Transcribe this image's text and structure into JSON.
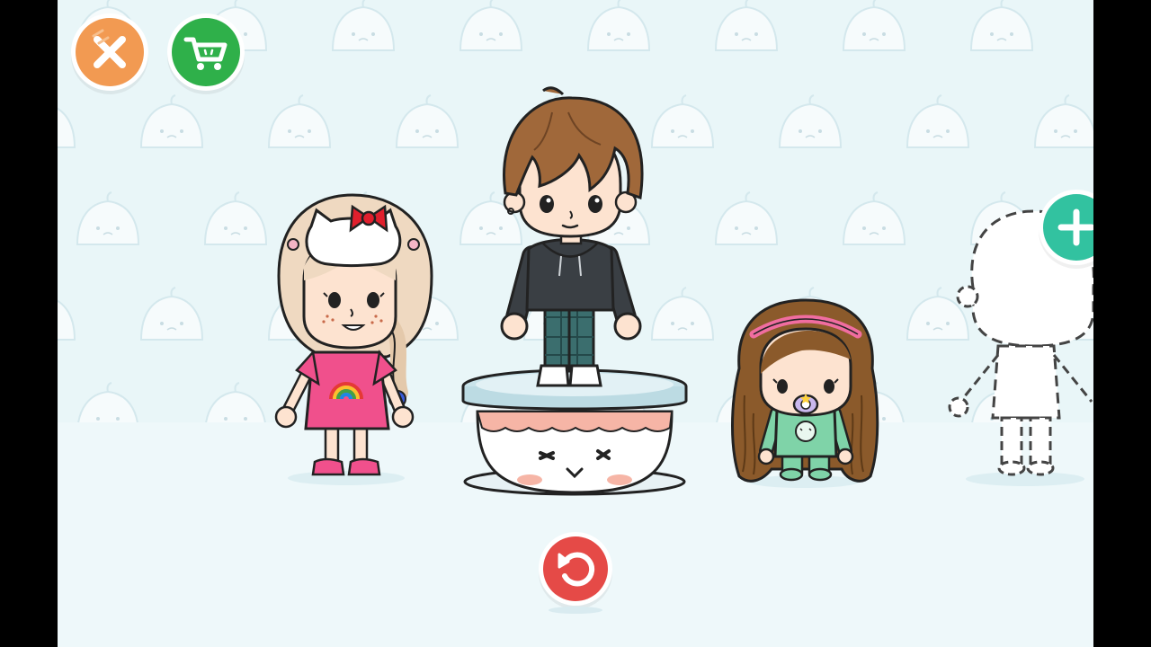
{
  "scene": {
    "background_color": "#e9f6f8",
    "floor_color": "#eef8fa",
    "pattern_icon": "dumpling-face-icon"
  },
  "toolbar": {
    "close": {
      "icon": "close-icon",
      "color": "#f29a52"
    },
    "shop": {
      "icon": "shopping-cart-icon",
      "color": "#2fb04a"
    }
  },
  "controls": {
    "undo": {
      "icon": "undo-icon",
      "color": "#e54a47"
    },
    "add_character": {
      "icon": "plus-icon",
      "color": "#32c2a0"
    }
  },
  "characters": [
    {
      "id": "girl-pink-dress",
      "icon": "girl-character-icon",
      "hair": "#efd9c1",
      "outfit": "#f0508c"
    },
    {
      "id": "boy-dark-hoodie",
      "icon": "boy-character-icon",
      "hair": "#a0683a",
      "outfit": "#3a3f44",
      "selected": true
    },
    {
      "id": "toddler-long-hair",
      "icon": "toddler-character-icon",
      "hair": "#8b5a2b",
      "outfit": "#7fd3a8"
    },
    {
      "id": "empty-slot",
      "icon": "character-silhouette-icon"
    }
  ],
  "pedestal": {
    "icon": "dumpling-pedestal-icon",
    "top_color": "#c9e3ea",
    "body_color": "#ffffff"
  }
}
